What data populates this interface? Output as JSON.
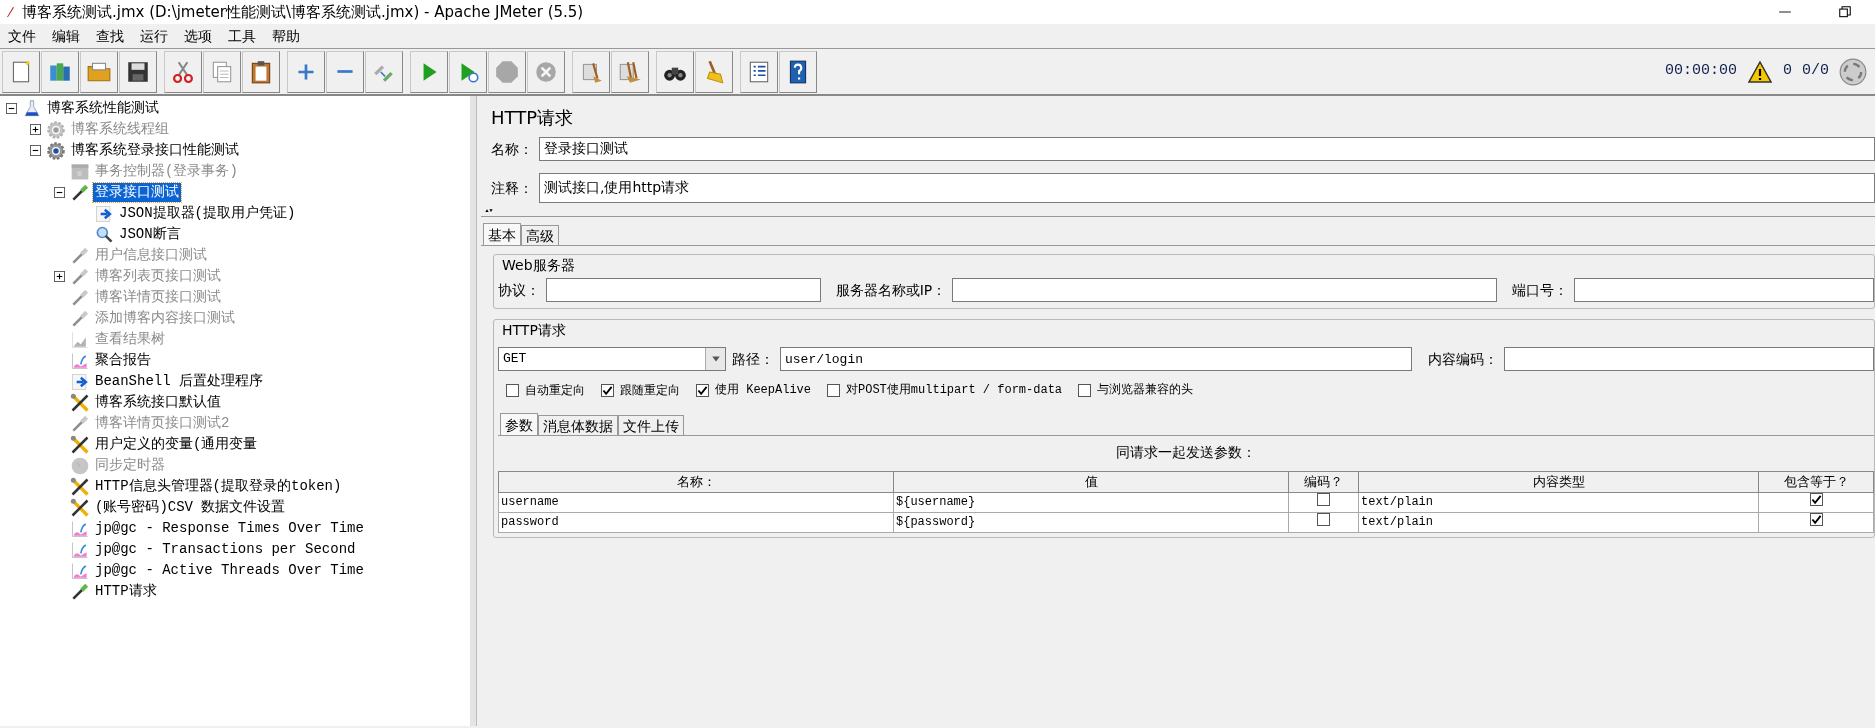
{
  "window": {
    "title": "博客系统测试.jmx (D:\\jmeter性能测试\\博客系统测试.jmx) - Apache JMeter (5.5)"
  },
  "menu": [
    "文件",
    "编辑",
    "查找",
    "运行",
    "选项",
    "工具",
    "帮助"
  ],
  "toolbar": [
    {
      "kind": "new",
      "disabled": false
    },
    {
      "kind": "templates",
      "disabled": false
    },
    {
      "kind": "open",
      "disabled": false
    },
    {
      "kind": "save",
      "disabled": false
    },
    {
      "kind": "cut",
      "disabled": false
    },
    {
      "kind": "copy",
      "disabled": false
    },
    {
      "kind": "paste",
      "disabled": false
    },
    {
      "kind": "expand",
      "disabled": false
    },
    {
      "kind": "collapse",
      "disabled": false
    },
    {
      "kind": "toggle",
      "disabled": false
    },
    {
      "kind": "start",
      "disabled": false
    },
    {
      "kind": "start-no-pause",
      "disabled": false
    },
    {
      "kind": "stop",
      "disabled": true
    },
    {
      "kind": "shutdown",
      "disabled": true
    },
    {
      "kind": "clear",
      "disabled": false
    },
    {
      "kind": "clear-all",
      "disabled": false
    },
    {
      "kind": "search",
      "disabled": false
    },
    {
      "kind": "reset-search",
      "disabled": false
    },
    {
      "kind": "function-helper",
      "disabled": false
    },
    {
      "kind": "help",
      "disabled": false
    }
  ],
  "status": {
    "elapsed": "00:00:00",
    "warnings": "0",
    "threads": "0/0"
  },
  "tree": [
    {
      "label": "博客系统性能测试",
      "kind": "flask",
      "disabled": false,
      "selected": false,
      "expanded": true,
      "children": [
        {
          "label": "博客系统线程组",
          "kind": "gear",
          "disabled": true,
          "selected": false,
          "expanded": false
        },
        {
          "label": "博客系统登录接口性能测试",
          "kind": "gear",
          "disabled": false,
          "selected": false,
          "expanded": true,
          "children": [
            {
              "label": "事务控制器(登录事务)",
              "kind": "controller",
              "disabled": true,
              "selected": false
            },
            {
              "label": "登录接口测试",
              "kind": "sampler",
              "disabled": false,
              "selected": true,
              "expanded": true,
              "children": [
                {
                  "label": "JSON提取器(提取用户凭证)",
                  "kind": "extractor",
                  "disabled": false,
                  "selected": false
                },
                {
                  "label": "JSON断言",
                  "kind": "assertion",
                  "disabled": false,
                  "selected": false
                }
              ]
            },
            {
              "label": "用户信息接口测试",
              "kind": "sampler",
              "disabled": true,
              "selected": false
            },
            {
              "label": "博客列表页接口测试",
              "kind": "sampler",
              "disabled": true,
              "selected": false,
              "expanded": false
            },
            {
              "label": "博客详情页接口测试",
              "kind": "sampler",
              "disabled": true,
              "selected": false
            },
            {
              "label": "添加博客内容接口测试",
              "kind": "sampler",
              "disabled": true,
              "selected": false
            },
            {
              "label": "查看结果树",
              "kind": "chart",
              "disabled": true,
              "selected": false
            },
            {
              "label": "聚合报告",
              "kind": "listener",
              "disabled": false,
              "selected": false
            },
            {
              "label": "BeanShell 后置处理程序",
              "kind": "extractor",
              "disabled": false,
              "selected": false
            },
            {
              "label": "博客系统接口默认值",
              "kind": "config",
              "disabled": false,
              "selected": false
            },
            {
              "label": "博客详情页接口测试2",
              "kind": "sampler",
              "disabled": true,
              "selected": false
            },
            {
              "label": "用户定义的变量(通用变量",
              "kind": "config",
              "disabled": false,
              "selected": false
            },
            {
              "label": "同步定时器",
              "kind": "timer",
              "disabled": true,
              "selected": false
            },
            {
              "label": "HTTP信息头管理器(提取登录的token)",
              "kind": "config",
              "disabled": false,
              "selected": false
            },
            {
              "label": "(账号密码)CSV 数据文件设置",
              "kind": "config",
              "disabled": false,
              "selected": false
            },
            {
              "label": "jp@gc - Response Times Over Time",
              "kind": "listener",
              "disabled": false,
              "selected": false
            },
            {
              "label": "jp@gc - Transactions per Second",
              "kind": "listener",
              "disabled": false,
              "selected": false
            },
            {
              "label": "jp@gc - Active Threads Over Time",
              "kind": "listener",
              "disabled": false,
              "selected": false
            },
            {
              "label": "HTTP请求",
              "kind": "sampler",
              "disabled": false,
              "selected": false
            }
          ]
        }
      ]
    }
  ],
  "editor": {
    "title": "HTTP请求",
    "name_label": "名称：",
    "name": "登录接口测试",
    "comment_label": "注释：",
    "comment": "测试接口,使用http请求",
    "tabs": [
      {
        "label": "基本",
        "selected": true
      },
      {
        "label": "高级",
        "selected": false
      }
    ],
    "web_server": {
      "legend": "Web服务器",
      "fields": [
        {
          "label": "协议："
        },
        {
          "label": "服务器名称或IP："
        },
        {
          "label": "端口号："
        }
      ]
    },
    "http": {
      "legend": "HTTP请求",
      "method": "GET",
      "path_label": "路径：",
      "path": "user/login",
      "encoding_label": "内容编码：",
      "options": [
        {
          "label": "自动重定向",
          "checked": false
        },
        {
          "label": "跟随重定向",
          "checked": true
        },
        {
          "label": "使用 KeepAlive",
          "checked": true
        },
        {
          "label": "对POST使用multipart / form-data",
          "checked": false
        },
        {
          "label": "与浏览器兼容的头",
          "checked": false
        }
      ]
    },
    "subtabs": [
      {
        "label": "参数",
        "selected": true
      },
      {
        "label": "消息体数据",
        "selected": false
      },
      {
        "label": "文件上传",
        "selected": false
      }
    ],
    "params_caption": "同请求一起发送参数：",
    "columns": [
      "名称：",
      "值",
      "编码？",
      "内容类型",
      "包含等于？"
    ],
    "rows": [
      {
        "name": "username",
        "value": "${username}",
        "encode": false,
        "content_type": "text/plain",
        "include_equals": true
      },
      {
        "name": "password",
        "value": "${password}",
        "encode": false,
        "content_type": "text/plain",
        "include_equals": true
      }
    ]
  }
}
